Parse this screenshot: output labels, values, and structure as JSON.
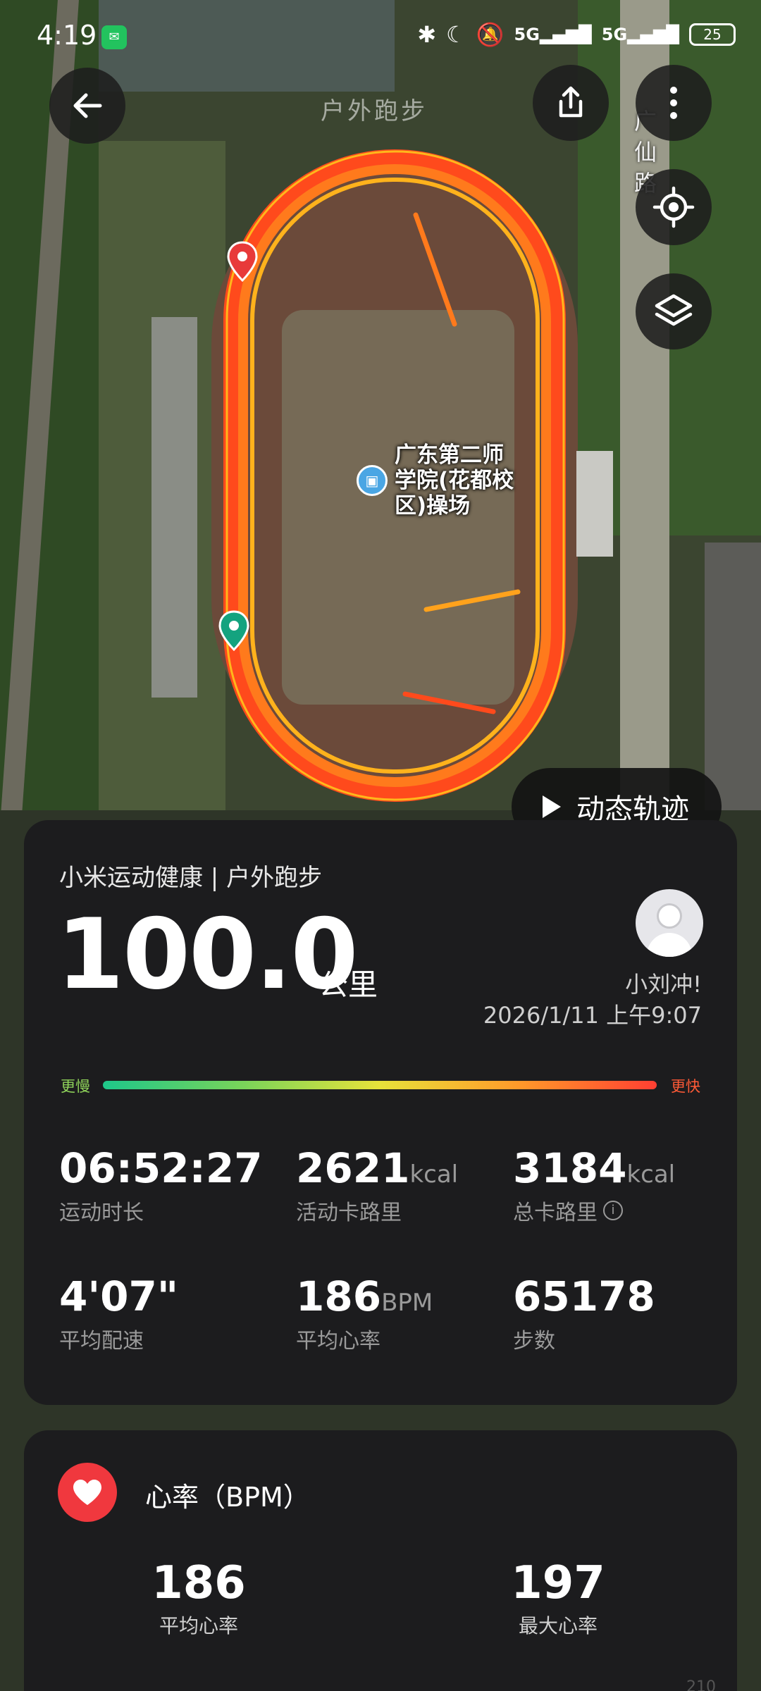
{
  "status_bar": {
    "time": "4:19",
    "signal_1": "5G",
    "signal_2": "5G",
    "battery": "25"
  },
  "map": {
    "faded_label": "户外跑步",
    "road_label": "广仙路",
    "poi_label": "广东第二师范学院(花都校区)操场",
    "poi_lines": [
      "广东第二师",
      "学院(花都校",
      "区)操场"
    ],
    "route_color": "#ff5a1f",
    "start_pin_color": "#14a37f",
    "end_pin_color": "#e83a3a"
  },
  "buttons": {
    "dynamic_track": "动态轨迹"
  },
  "summary": {
    "source": "小米运动健康 | 户外跑步",
    "distance": "100.0",
    "distance_unit": "公里",
    "username": "小刘冲!",
    "datetime": "2026/1/11 上午9:07",
    "pace_slow_label": "更慢",
    "pace_fast_label": "更快",
    "stats": [
      {
        "value": "06:52:27",
        "unit": "",
        "label": "运动时长"
      },
      {
        "value": "2621",
        "unit": "kcal",
        "label": "活动卡路里"
      },
      {
        "value": "3184",
        "unit": "kcal",
        "label": "总卡路里"
      },
      {
        "value": "4'07\"",
        "unit": "",
        "label": "平均配速"
      },
      {
        "value": "186",
        "unit": "BPM",
        "label": "平均心率"
      },
      {
        "value": "65178",
        "unit": "",
        "label": "步数"
      }
    ]
  },
  "heart_rate": {
    "title": "心率（BPM）",
    "avg_value": "186",
    "avg_label": "平均心率",
    "max_value": "197",
    "max_label": "最大心率",
    "axis_tick": "210"
  }
}
